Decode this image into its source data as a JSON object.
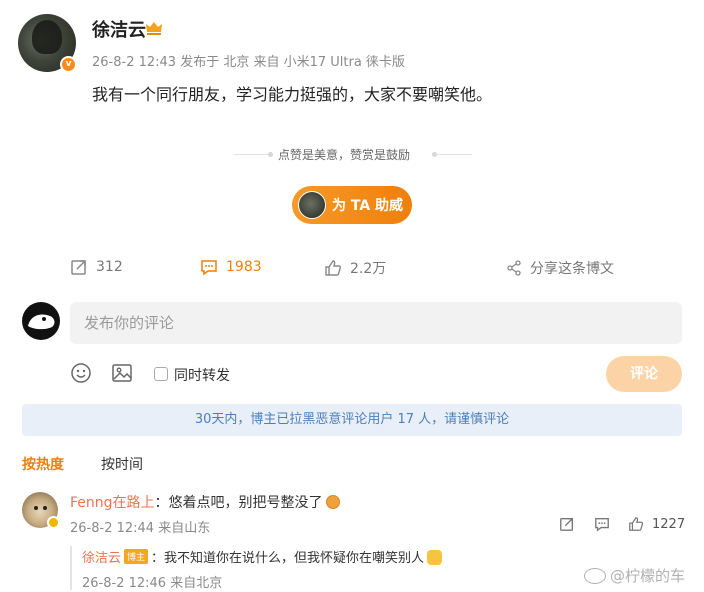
{
  "post": {
    "author": "徐洁云",
    "meta": "26-8-2 12:43 发布于 北京  来自 小米17 Ultra 徕卡版",
    "text": "我有一个同行朋友，学习能力挺强的，大家不要嘲笑他。",
    "tip": "点赞是美意，赞赏是鼓励",
    "support_label": "为 TA 助威",
    "verified_badge": "v"
  },
  "actions": {
    "repost_count": "312",
    "comment_count": "1983",
    "like_count": "2.2万",
    "share_label": "分享这条博文"
  },
  "composer": {
    "placeholder": "发布你的评论",
    "also_repost": "同时转发",
    "submit": "评论"
  },
  "notice": "30天内，博主已拉黑恶意评论用户 17 人，请谨慎评论",
  "sort": {
    "hot": "按热度",
    "time": "按时间"
  },
  "comments": [
    {
      "user": "Fenng在路上",
      "text": "：悠着点吧，别把号整没了",
      "meta": "26-8-2 12:44 来自山东",
      "like_count": "1227",
      "reply": {
        "user": "徐洁云",
        "tag": "博主",
        "text": "：我不知道你在说什么，但我怀疑你在嘲笑别人",
        "meta": "26-8-2 12:46 来自北京"
      }
    }
  ],
  "watermark": "@柠檬的车",
  "colors": {
    "accent": "#f07f0b",
    "username": "#eb7350",
    "notice_bg": "#e8eff9",
    "notice_text": "#4e7fb8"
  }
}
